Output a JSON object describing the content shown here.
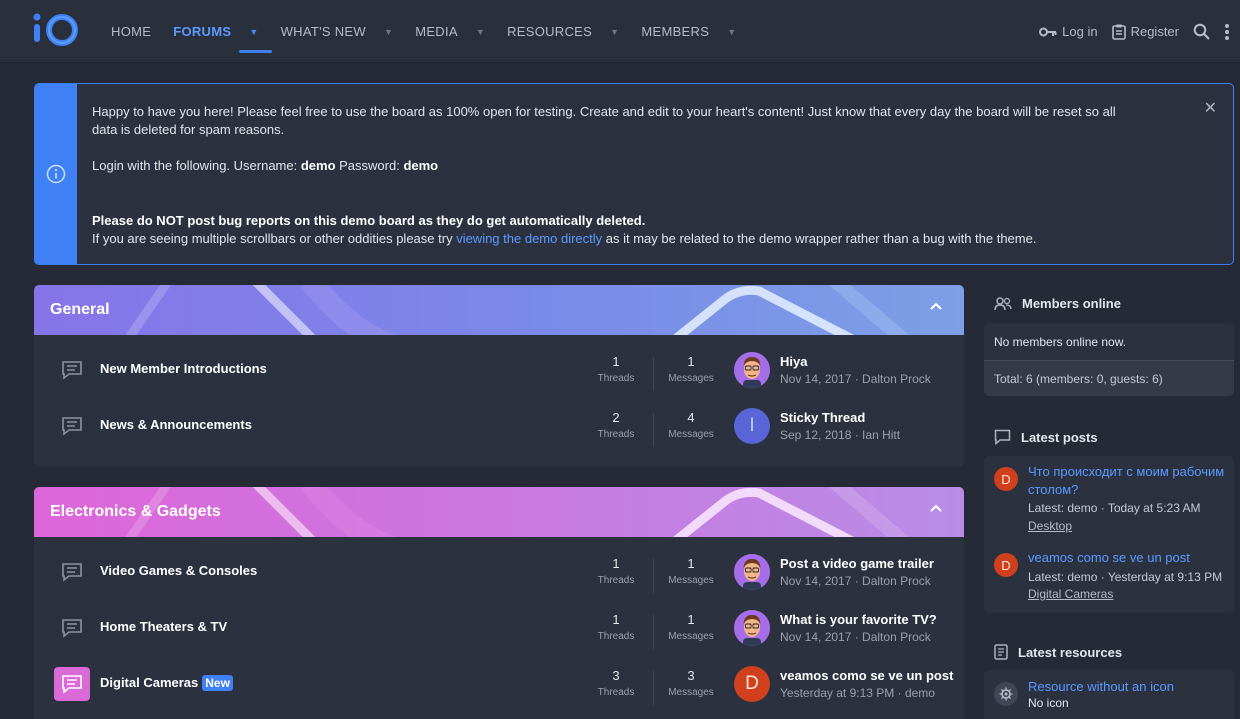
{
  "header": {
    "logo_text": "iO",
    "nav": [
      {
        "label": "HOME",
        "has_menu": false,
        "active": false
      },
      {
        "label": "FORUMS",
        "has_menu": true,
        "active": true
      },
      {
        "label": "WHAT'S NEW",
        "has_menu": true,
        "active": false
      },
      {
        "label": "MEDIA",
        "has_menu": true,
        "active": false
      },
      {
        "label": "RESOURCES",
        "has_menu": true,
        "active": false
      },
      {
        "label": "MEMBERS",
        "has_menu": true,
        "active": false
      }
    ],
    "login_label": "Log in",
    "register_label": "Register"
  },
  "notice": {
    "line1": "Happy to have you here! Please feel free to use the board as 100% open for testing. Create and edit to your heart's content! Just know that every day the board will be reset so all data is deleted for spam reasons.",
    "login_prefix": "Login with the following. Username: ",
    "username": "demo",
    "password_label": " Password: ",
    "password": "demo",
    "warning": "Please do NOT post bug reports on this demo board as they do get automatically deleted.",
    "scroll_prefix": "If you are seeing multiple scrollbars or other oddities please try ",
    "scroll_link": "viewing the demo directly",
    "scroll_suffix": " as it may be related to the demo wrapper rather than a bug with the theme."
  },
  "categories": [
    {
      "title": "General",
      "nodes": [
        {
          "title": "New Member Introductions",
          "threads": "1",
          "messages": "1",
          "last_title": "Hiya",
          "last_meta": "Nov 14, 2017 · Dalton Prock",
          "avatar": "face"
        },
        {
          "title": "News & Announcements",
          "threads": "2",
          "messages": "4",
          "last_title": "Sticky Thread",
          "last_meta": "Sep 12, 2018 · Ian Hitt",
          "avatar": "I"
        }
      ]
    },
    {
      "title": "Electronics & Gadgets",
      "nodes": [
        {
          "title": "Video Games & Consoles",
          "threads": "1",
          "messages": "1",
          "last_title": "Post a video game trailer",
          "last_meta": "Nov 14, 2017 · Dalton Prock",
          "avatar": "face"
        },
        {
          "title": "Home Theaters & TV",
          "threads": "1",
          "messages": "1",
          "last_title": "What is your favorite TV?",
          "last_meta": "Nov 14, 2017 · Dalton Prock",
          "avatar": "face"
        },
        {
          "title": "Digital Cameras",
          "badge": "New",
          "threads": "3",
          "messages": "3",
          "last_title": "veamos como se ve un post",
          "last_meta": "Yesterday at 9:13 PM · demo",
          "avatar": "D"
        }
      ]
    }
  ],
  "stat_labels": {
    "threads": "Threads",
    "messages": "Messages"
  },
  "sidebar": {
    "members_online": {
      "title": "Members online",
      "empty": "No members online now.",
      "total": "Total: 6 (members: 0, guests: 6)"
    },
    "latest_posts": {
      "title": "Latest posts",
      "items": [
        {
          "avatar": "D",
          "title": "Что происходит с моим рабочим столом?",
          "meta": "Latest: demo · Today at 5:23 AM",
          "forum": "Desktop"
        },
        {
          "avatar": "D",
          "title": "veamos como se ve un post",
          "meta": "Latest: demo · Yesterday at 9:13 PM",
          "forum": "Digital Cameras"
        }
      ]
    },
    "latest_resources": {
      "title": "Latest resources",
      "items": [
        {
          "title": "Resource without an icon",
          "sub": "No icon"
        }
      ]
    }
  },
  "colors": {
    "accent": "#3f80f4",
    "link": "#5a9bff",
    "background": "#252a36",
    "panel": "#2c3140"
  }
}
